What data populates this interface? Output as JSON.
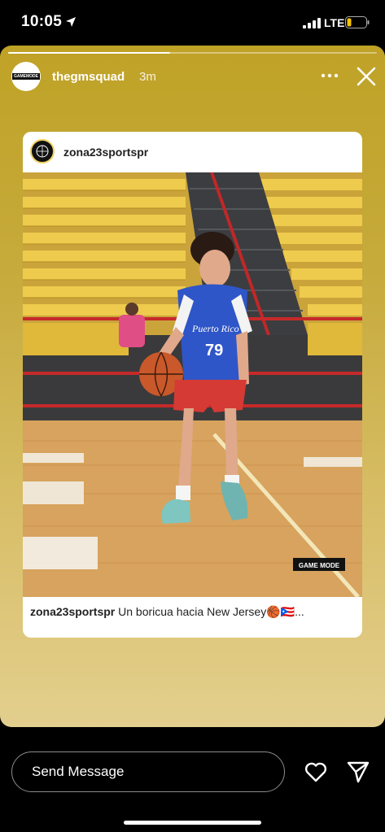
{
  "status_bar": {
    "time": "10:05",
    "network": "LTE"
  },
  "story": {
    "progress": 0.44,
    "username": "thegmsquad",
    "time_ago": "3m",
    "avatar_text": "GAMEMODE"
  },
  "post": {
    "username": "zona23sportspr",
    "photo": {
      "jersey_team": "Puerto Rico",
      "jersey_number": "79",
      "watermark": "GAME MODE"
    },
    "caption_username": "zona23sportspr",
    "caption_text": "Un boricua hacia New Jersey🏀🇵🇷..."
  },
  "footer": {
    "message_placeholder": "Send Message"
  },
  "colors": {
    "story_gradient_top": "#bfa226",
    "story_gradient_bottom": "#e3cf8e",
    "seat_yellow": "#e8c23a"
  }
}
